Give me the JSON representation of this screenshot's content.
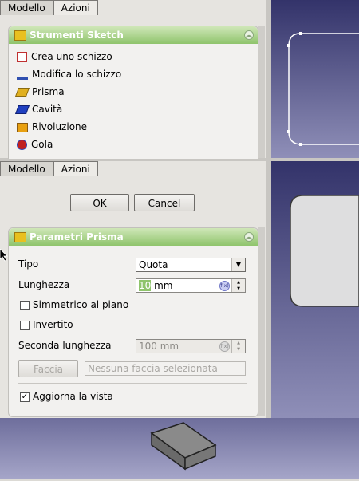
{
  "top_panel": {
    "tabs": [
      {
        "label": "Modello"
      },
      {
        "label": "Azioni"
      }
    ],
    "taskbox": {
      "title": "Strumenti Sketch",
      "items": [
        {
          "label": "Crea uno schizzo",
          "icon": "new-sketch-icon"
        },
        {
          "label": "Modifica lo schizzo",
          "icon": "edit-sketch-icon"
        },
        {
          "label": "Prisma",
          "icon": "pad-icon"
        },
        {
          "label": "Cavità",
          "icon": "pocket-icon"
        },
        {
          "label": "Rivoluzione",
          "icon": "revolution-icon"
        },
        {
          "label": "Gola",
          "icon": "groove-icon"
        }
      ]
    }
  },
  "bottom_panel": {
    "tabs": [
      {
        "label": "Modello"
      },
      {
        "label": "Azioni"
      }
    ],
    "ok_label": "OK",
    "cancel_label": "Cancel",
    "taskbox": {
      "title": "Parametri Prisma",
      "type_label": "Tipo",
      "type_value": "Quota",
      "length_label": "Lunghezza",
      "length_number": "10",
      "length_unit": " mm",
      "symmetric_label": "Simmetrico al piano",
      "symmetric_checked": false,
      "reversed_label": "Invertito",
      "reversed_checked": false,
      "second_length_label": "Seconda lunghezza",
      "second_length_value": "100 mm",
      "face_button_label": "Faccia",
      "face_placeholder": "Nessuna faccia selezionata",
      "update_view_label": "Aggiorna la vista",
      "update_view_checked": true,
      "check_mark": "✓"
    }
  },
  "colors": {
    "viewport_top": "#33336a",
    "viewport_bottom": "#8f8fb8",
    "taskbox_header": "#8fc46c"
  }
}
